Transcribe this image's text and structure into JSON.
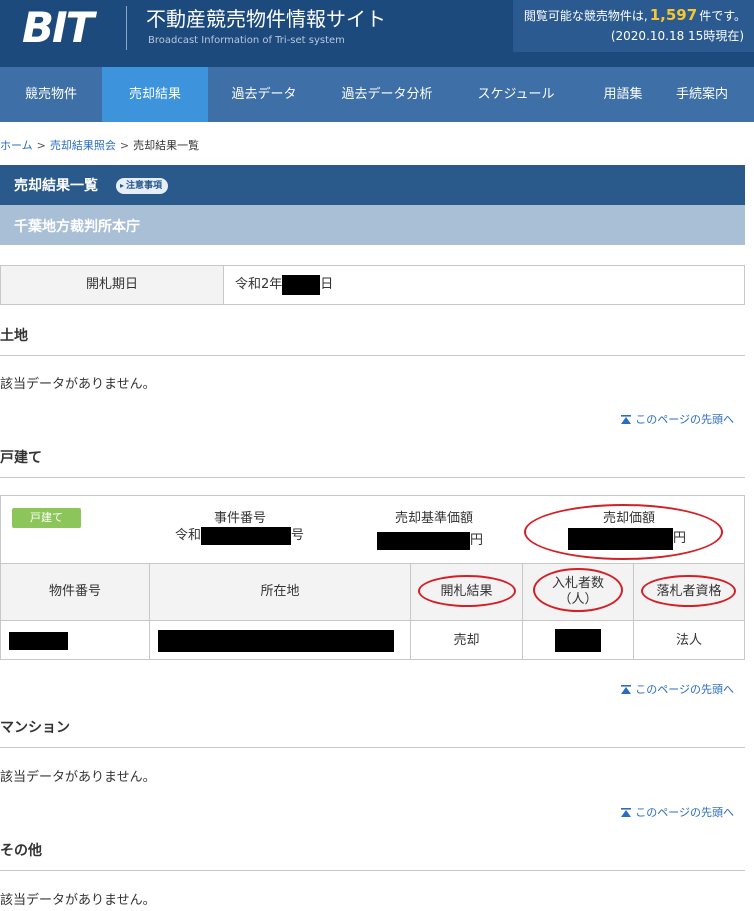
{
  "header": {
    "logo": "BIT",
    "site_title": "不動産競売物件情報サイト",
    "site_subtitle": "Broadcast Information of Tri-set system",
    "count_prefix": "閲覧可能な競売物件は,",
    "count_value": "1,597",
    "count_suffix": "件です。",
    "as_of": "(2020.10.18 15時現在)"
  },
  "nav": {
    "items": [
      {
        "label": "競売物件",
        "active": false
      },
      {
        "label": "売却結果",
        "active": true
      },
      {
        "label": "過去データ",
        "active": false
      },
      {
        "label": "過去データ分析",
        "active": false
      },
      {
        "label": "スケジュール",
        "active": false
      },
      {
        "label": "用語集",
        "active": false
      },
      {
        "label": "手続案内",
        "active": false
      }
    ]
  },
  "breadcrumb": {
    "home": "ホーム",
    "sep": ">",
    "inquiry": "売却結果照会",
    "current": "売却結果一覧"
  },
  "title": {
    "main": "売却結果一覧",
    "notice": "注意事項",
    "court": "千葉地方裁判所本庁"
  },
  "opening_date": {
    "label": "開札期日",
    "prefix": "令和2年",
    "suffix": "日"
  },
  "sections": {
    "land": {
      "heading": "土地",
      "empty": "該当データがありません。"
    },
    "house": {
      "heading": "戸建て"
    },
    "mansion": {
      "heading": "マンション",
      "empty": "該当データがありません。"
    },
    "other": {
      "heading": "その他",
      "empty": "該当データがありません。"
    }
  },
  "pagetop_label": "このページの先頭へ",
  "house_block": {
    "tag": "戸建て",
    "case_number_label": "事件番号",
    "case_prefix": "令和",
    "case_suffix": "号",
    "base_price_label": "売却基準価額",
    "base_price_unit": "円",
    "sale_price_label": "売却価額",
    "sale_price_unit": "円",
    "columns": [
      "物件番号",
      "所在地",
      "開札結果",
      "入札者数\n（人）",
      "落札者資格"
    ],
    "row": {
      "result": "売却",
      "qualification": "法人"
    }
  },
  "colors": {
    "header": "#1d4a7d",
    "nav": "#3e6fa6",
    "nav_active": "#3d94dc",
    "titlebar": "#2a5a8c",
    "subbar": "#a9bfd6",
    "tag": "#8cc65a",
    "link": "#2a6dbf",
    "highlight": "#d41f26",
    "count": "#f7c630"
  }
}
